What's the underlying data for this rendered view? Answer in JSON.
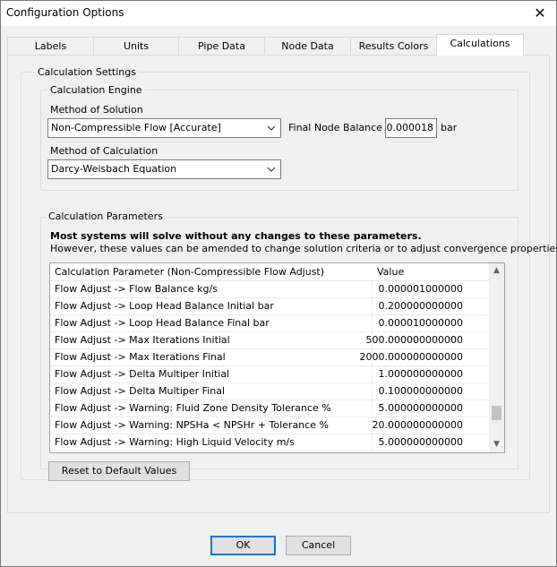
{
  "window": {
    "title": "Configuration Options",
    "close_glyph": "✕"
  },
  "tabs": [
    {
      "label": "Labels"
    },
    {
      "label": "Units"
    },
    {
      "label": "Pipe Data"
    },
    {
      "label": "Node Data"
    },
    {
      "label": "Results Colors"
    },
    {
      "label": "Calculations"
    }
  ],
  "active_tab": "Calculations",
  "calc_settings": {
    "legend": "Calculation Settings",
    "engine": {
      "legend": "Calculation Engine",
      "solution_label": "Method of Solution",
      "solution_value": "Non-Compressible Flow [Accurate]",
      "balance_label": "Final Node Balance to",
      "balance_value": "0.000018",
      "balance_unit": "bar",
      "calc_label": "Method of Calculation",
      "calc_value": "Darcy-Weisbach Equation"
    }
  },
  "calc_params": {
    "legend": "Calculation Parameters",
    "note_bold": "Most systems will solve without any changes to these parameters.",
    "note": "However, these values can be amended to change solution criteria or to adjust convergence properties.",
    "col_param": "Calculation Parameter (Non-Compressible Flow Adjust)",
    "col_value": "Value",
    "rows": [
      {
        "name": "Flow Adjust -> Flow Balance kg/s",
        "value": "0.000001000000"
      },
      {
        "name": "Flow Adjust -> Loop Head Balance Initial bar",
        "value": "0.200000000000"
      },
      {
        "name": "Flow Adjust -> Loop Head Balance Final bar",
        "value": "0.000010000000"
      },
      {
        "name": "Flow Adjust -> Max Iterations Initial",
        "value": "500.000000000000"
      },
      {
        "name": "Flow Adjust -> Max Iterations Final",
        "value": "2000.000000000000"
      },
      {
        "name": "Flow Adjust -> Delta Multiper Initial",
        "value": "1.000000000000"
      },
      {
        "name": "Flow Adjust -> Delta Multiper Final",
        "value": "0.100000000000"
      },
      {
        "name": "Flow Adjust -> Warning: Fluid Zone Density Tolerance %",
        "value": "5.000000000000"
      },
      {
        "name": "Flow Adjust -> Warning: NPSHa < NPSHr + Tolerance %",
        "value": "20.000000000000"
      },
      {
        "name": "Flow Adjust -> Warning: High Liquid Velocity m/s",
        "value": "5.000000000000"
      }
    ],
    "scroll_position": 0.88,
    "reset_label": "Reset to Default Values"
  },
  "buttons": {
    "ok": "OK",
    "cancel": "Cancel"
  },
  "colors": {
    "accent": "#0078d7",
    "panel": "#f0f0f0"
  },
  "icons": {
    "dropdown": "chevron-down-icon",
    "close": "close-icon",
    "scroll_up": "arrow-up-icon",
    "scroll_down": "arrow-down-icon"
  }
}
